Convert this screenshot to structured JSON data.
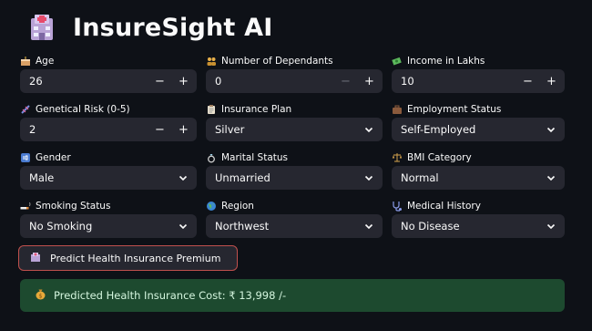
{
  "app": {
    "title": "InsureSight AI"
  },
  "fields": [
    {
      "label": "Age",
      "icon": "birthday-cake-icon",
      "type": "number",
      "value": "26"
    },
    {
      "label": "Number of Dependants",
      "icon": "people-icon",
      "type": "number",
      "value": "0"
    },
    {
      "label": "Income in Lakhs",
      "icon": "money-icon",
      "type": "number",
      "value": "10"
    },
    {
      "label": "Genetical Risk (0-5)",
      "icon": "dna-icon",
      "type": "number",
      "value": "2"
    },
    {
      "label": "Insurance Plan",
      "icon": "clipboard-icon",
      "type": "select",
      "value": "Silver"
    },
    {
      "label": "Employment Status",
      "icon": "briefcase-icon",
      "type": "select",
      "value": "Self-Employed"
    },
    {
      "label": "Gender",
      "icon": "id-icon",
      "type": "select",
      "value": "Male"
    },
    {
      "label": "Marital Status",
      "icon": "ring-icon",
      "type": "select",
      "value": "Unmarried"
    },
    {
      "label": "BMI Category",
      "icon": "scale-icon",
      "type": "select",
      "value": "Normal"
    },
    {
      "label": "Smoking Status",
      "icon": "cigarette-icon",
      "type": "select",
      "value": "No Smoking"
    },
    {
      "label": "Region",
      "icon": "globe-icon",
      "type": "select",
      "value": "Northwest"
    },
    {
      "label": "Medical History",
      "icon": "stethoscope-icon",
      "type": "select",
      "value": "No Disease"
    }
  ],
  "stepper": {
    "minus": "−",
    "plus": "+"
  },
  "predict_button": {
    "label": "Predict Health Insurance Premium",
    "icon": "hospital-icon"
  },
  "result": {
    "text": "Predicted Health Insurance Cost: ₹ 13,998 /-",
    "icon": "money-bag-icon"
  },
  "colors": {
    "background": "#0e1117",
    "input": "#262730",
    "accent": "#c0504d",
    "success": "#1d4a2f"
  }
}
